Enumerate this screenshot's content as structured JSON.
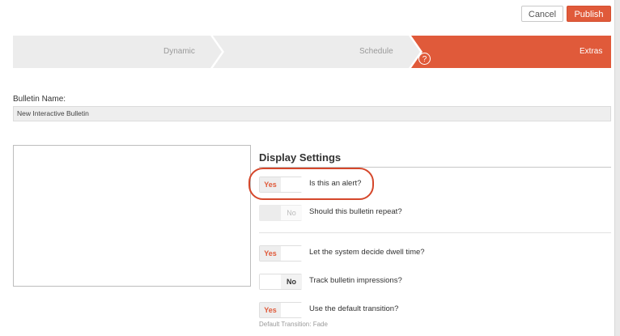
{
  "header": {
    "cancel_label": "Cancel",
    "publish_label": "Publish"
  },
  "wizard": {
    "steps": [
      {
        "label": "Dynamic",
        "active": false
      },
      {
        "label": "Schedule",
        "active": false
      },
      {
        "label": "Extras",
        "active": true
      }
    ],
    "help_glyph": "?"
  },
  "form": {
    "bulletin_name_label": "Bulletin Name:",
    "bulletin_name_value": "New Interactive Bulletin"
  },
  "display_settings": {
    "title": "Display Settings",
    "toggles": [
      {
        "yes": "Yes",
        "no": "",
        "state": "on",
        "question": "Is this an alert?"
      },
      {
        "yes": "",
        "no": "No",
        "state": "disabled",
        "question": "Should this bulletin repeat?"
      },
      {
        "yes": "Yes",
        "no": "",
        "state": "on",
        "question": "Let the system decide dwell time?"
      },
      {
        "yes": "",
        "no": "No",
        "state": "off",
        "question": "Track bulletin impressions?"
      },
      {
        "yes": "Yes",
        "no": "",
        "state": "on",
        "question": "Use the default transition?"
      }
    ],
    "default_transition_note": "Default Transition: Fade"
  },
  "colors": {
    "accent": "#e05a3a",
    "highlight": "#d5472b",
    "step_inactive": "#ececec"
  }
}
